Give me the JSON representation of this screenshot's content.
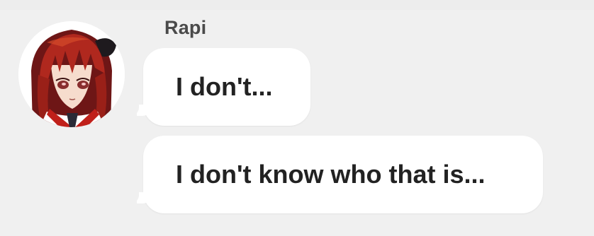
{
  "message": {
    "sender_name": "Rapi",
    "avatar_icon": "character-portrait-avatar",
    "lines": [
      "I don't...",
      "I don't know who that is..."
    ]
  },
  "colors": {
    "background": "#f0f0f0",
    "bubble": "#ffffff",
    "text": "#222222",
    "name": "#4a4a4a"
  }
}
